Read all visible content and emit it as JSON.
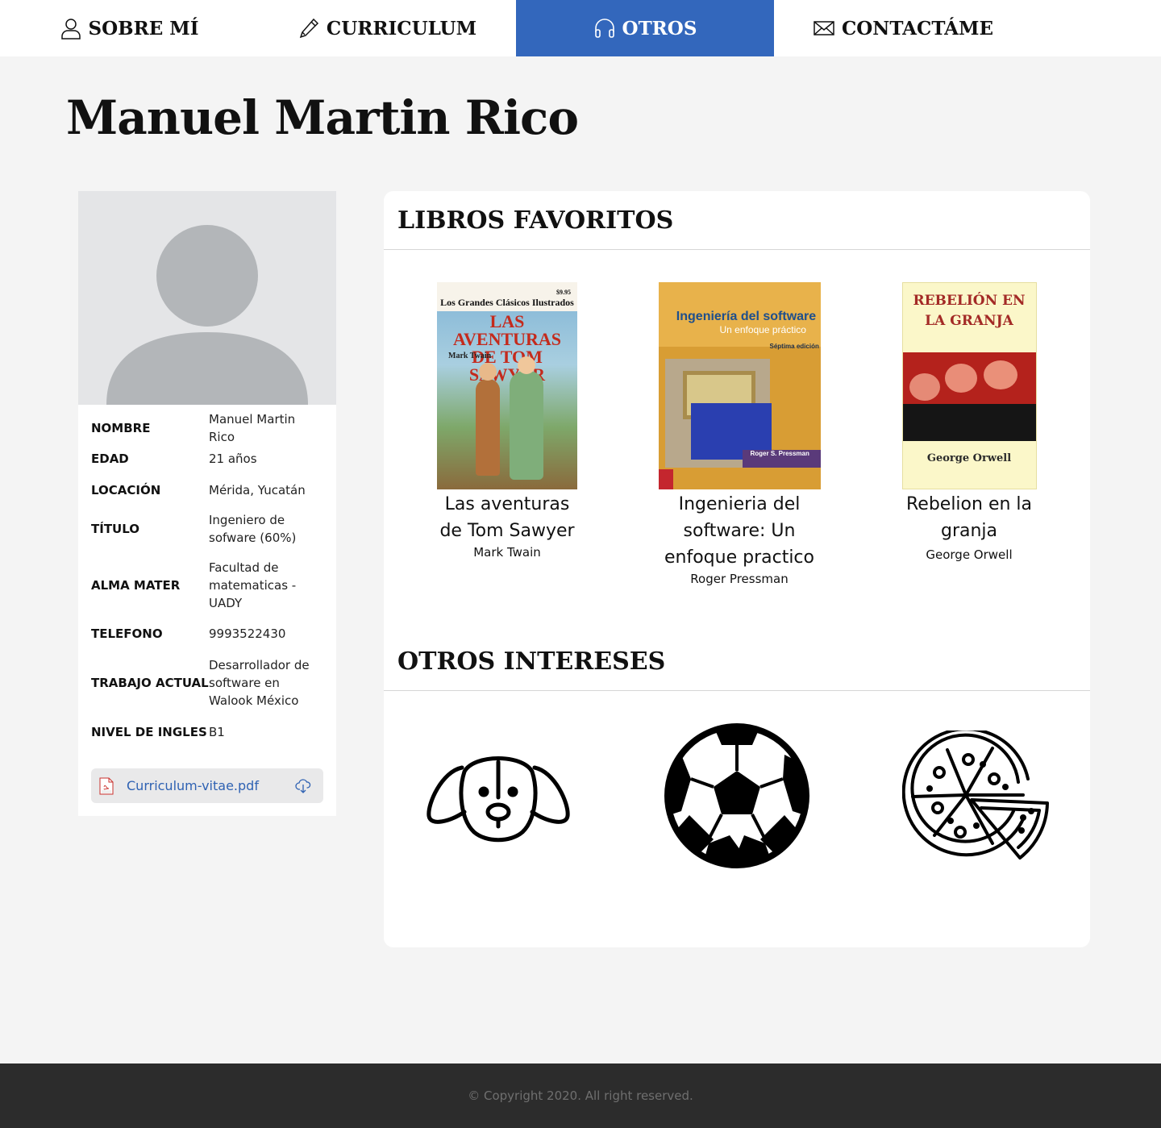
{
  "nav": {
    "items": [
      {
        "label": "SOBRE MÍ",
        "icon": "user-icon",
        "active": false
      },
      {
        "label": "CURRICULUM",
        "icon": "pencil-icon",
        "active": false
      },
      {
        "label": "OTROS",
        "icon": "headphones-icon",
        "active": true
      },
      {
        "label": "CONTACTÁME",
        "icon": "envelope-icon",
        "active": false
      }
    ],
    "active_color": "#3367bc"
  },
  "page": {
    "title": "Manuel Martin Rico"
  },
  "profile": {
    "avatar_icon": "avatar-placeholder-icon",
    "fields": [
      {
        "label": "NOMBRE",
        "value": "Manuel Martin Rico"
      },
      {
        "label": "EDAD",
        "value": "21 años"
      },
      {
        "label": "LOCACIÓN",
        "value": "Mérida, Yucatán"
      },
      {
        "label": "TÍTULO",
        "value": "Ingeniero de sofware (60%)"
      },
      {
        "label": "ALMA MATER",
        "value": "Facultad de matematicas - UADY"
      },
      {
        "label": "TELEFONO",
        "value": "9993522430"
      },
      {
        "label": "TRABAJO ACTUAL",
        "value": "Desarrollador de software en Walook México"
      },
      {
        "label": "NIVEL DE INGLES",
        "value": "B1"
      }
    ],
    "cv_file": {
      "name": "Curriculum-vitae.pdf",
      "icon": "pdf-icon",
      "action_icon": "cloud-download-icon"
    }
  },
  "books_section": {
    "title": "LIBROS FAVORITOS",
    "books": [
      {
        "title": "Las aventuras de Tom Sawyer",
        "author": "Mark Twain",
        "cover": {
          "series": "Los Grandes Clásicos Ilustrados",
          "price": "$9.95",
          "heading": "LAS AVENTURAS DE TOM SAWYER",
          "author": "Mark Twain"
        }
      },
      {
        "title": "Ingenieria del software: Un enfoque practico",
        "author": "Roger Pressman",
        "cover": {
          "heading": "Ingeniería del software",
          "subtitle": "Un enfoque práctico",
          "edition": "Séptima edición",
          "author": "Roger S. Pressman"
        }
      },
      {
        "title": "Rebelion en la granja",
        "author": "George Orwell",
        "cover": {
          "heading": "REBELIÓN EN LA GRANJA",
          "author": "George Orwell"
        }
      }
    ]
  },
  "interests_section": {
    "title": "OTROS INTERESES",
    "items": [
      {
        "icon": "dog-icon"
      },
      {
        "icon": "soccer-ball-icon"
      },
      {
        "icon": "pizza-icon"
      }
    ]
  },
  "footer": {
    "text": "© Copyright 2020. All right reserved."
  }
}
